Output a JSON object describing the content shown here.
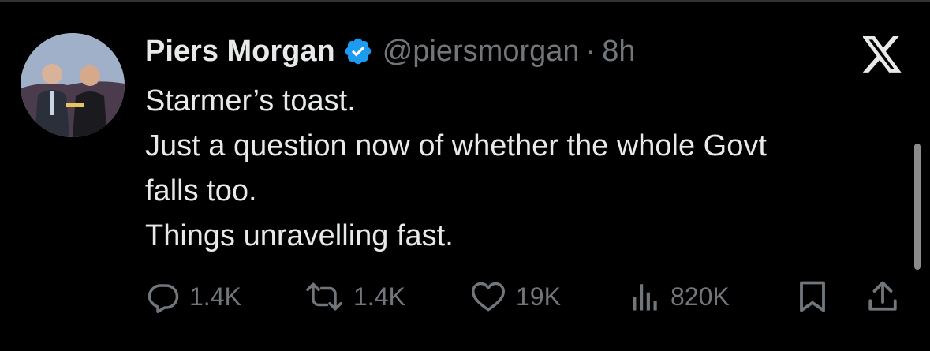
{
  "tweet": {
    "author_name": "Piers Morgan",
    "handle": "@piersmorgan",
    "separator": "·",
    "time": "8h",
    "lines": [
      "Starmer’s toast.",
      "Just a question now of whether the whole Govt",
      "falls too.",
      "Things unravelling fast."
    ]
  },
  "metrics": {
    "replies": "1.4K",
    "reposts": "1.4K",
    "likes": "19K",
    "views": "820K"
  },
  "icons": {
    "verified": "verified-badge-icon",
    "platform": "x-logo-icon",
    "reply": "reply-icon",
    "repost": "repost-icon",
    "like": "heart-icon",
    "views": "views-icon",
    "bookmark": "bookmark-icon",
    "share": "share-icon"
  },
  "colors": {
    "background": "#000000",
    "text": "#e7e9ea",
    "muted": "#71767b",
    "verified": "#1d9bf0"
  }
}
